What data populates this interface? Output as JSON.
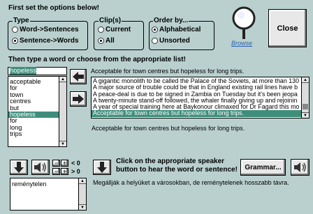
{
  "header": {
    "title": "First set the options below!",
    "prompt": "Then type a word or choose from the appropriate list!"
  },
  "options": {
    "type_group": {
      "title": "Type",
      "options": [
        "Word->Sentences",
        "Sentence->Words"
      ],
      "selected": 1
    },
    "clips_group": {
      "title": "Clip(s)",
      "options": [
        "Current",
        "All"
      ],
      "selected": 1
    },
    "order_group": {
      "title": "Order by...",
      "options": [
        "Alphabetical",
        "Unsorted"
      ],
      "selected": 0
    }
  },
  "browse_label": "Browse",
  "close_label": "Close",
  "search": {
    "value": "hopeless"
  },
  "word_list": {
    "items": [
      "acceptable",
      "for",
      "town",
      "centres",
      "but",
      "hopeless",
      "for",
      "long",
      "trips"
    ],
    "selected": 5
  },
  "sentence_header": "Acceptable for town centres but hopeless for long trips.",
  "sentence_list": {
    "items": [
      "A gigantic monolith to be called the Palace of the Soviets, at more than 130",
      "A major source of trouble could be that in England existing rail lines have b",
      "A peace-deal is due to be signed in Zambia on Tuesday but it's been jeopa",
      "A twenty-minute stand-off followed, the whaler finally giving up and rejoinin",
      "A year of special training here at Baykonour climaxed for Dr Fagard this mo",
      "Acceptable for town centres but hopeless for long trips."
    ],
    "selected": 5
  },
  "sentence_detail": "Acceptable for town centres but hopeless for long trips.",
  "speed_labels": {
    "lt": "< 0",
    "gt": "> 0"
  },
  "speaker_hint": "Click on the appropriate speaker button to hear the word or sentence!",
  "grammar_label": "Grammar...",
  "translation_word_list": {
    "items": [
      "reménytelen"
    ]
  },
  "translation_sentence": "Megállják a helyüket a városokban, de reménytelenek hosszabb távra."
}
